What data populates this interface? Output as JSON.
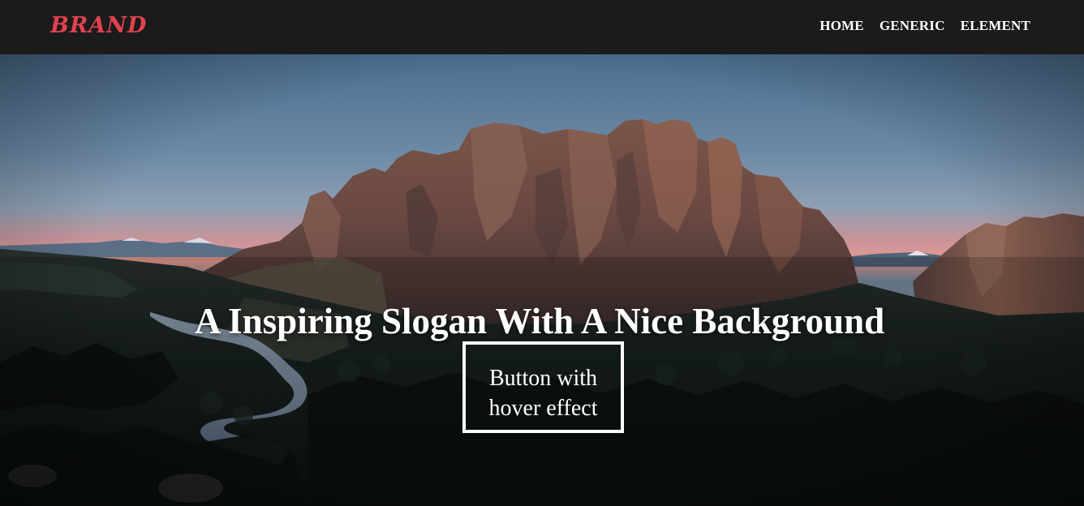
{
  "navbar": {
    "brand": "BRAND",
    "links": [
      "HOME",
      "GENERIC",
      "ELEMENT"
    ]
  },
  "hero": {
    "slogan": "A Inspiring Slogan With A Nice Background",
    "button_label": "Button with hover effect",
    "background": "mountain-landscape-photo"
  },
  "colors": {
    "navbar_bg": "#1b1b1b",
    "brand": "#e0424f",
    "text": "#ffffff"
  }
}
